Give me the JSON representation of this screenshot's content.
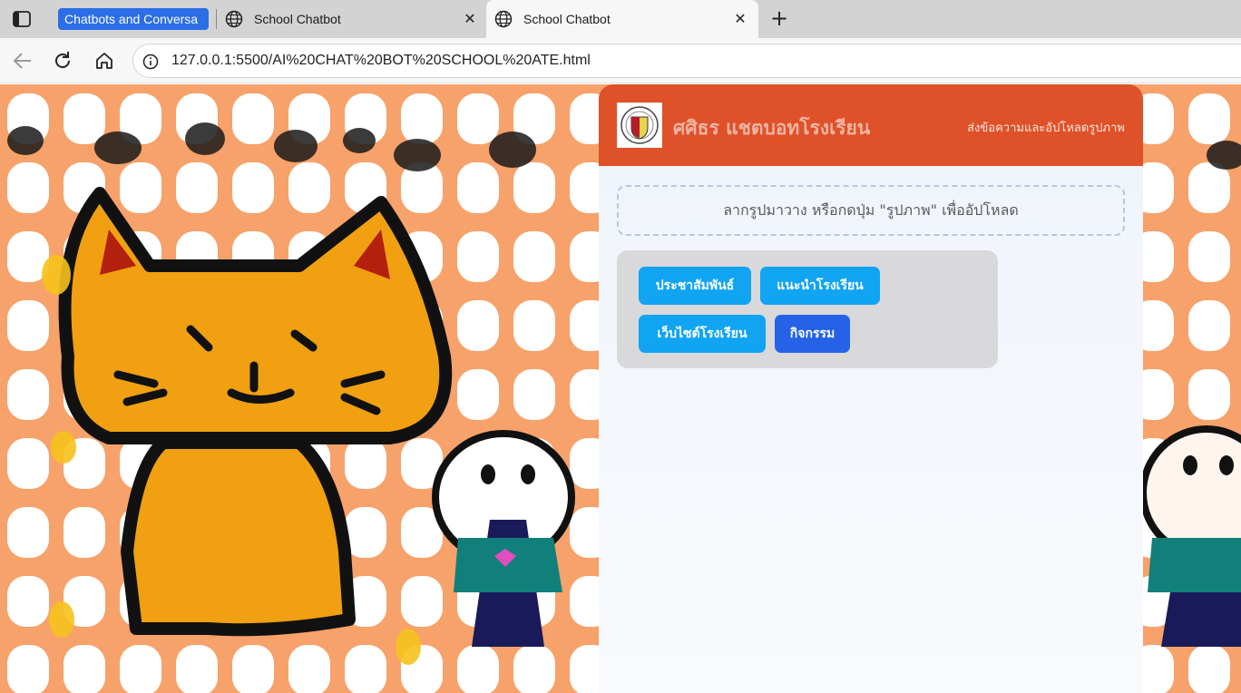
{
  "browser": {
    "tab_group_label": "Chatbots and Conversa",
    "tabs": [
      {
        "title": "School Chatbot",
        "active": false
      },
      {
        "title": "School Chatbot",
        "active": true
      }
    ],
    "address": "127.0.0.1:5500/AI%20CHAT%20BOT%20SCHOOL%20ATE.html"
  },
  "chat": {
    "title": "ศศิธร แชตบอทโรงเรียน",
    "subtitle": "ส่งข้อความและอัปโหลดรูปภาพ",
    "dropzone_text": "ลากรูปมาวาง หรือกดปุ่ม \"รูปภาพ\" เพื่ออัปโหลด",
    "quick_buttons": [
      {
        "label": "ประชาสัมพันธ์",
        "color": "#10a4f2"
      },
      {
        "label": "แนะนำโรงเรียน",
        "color": "#10a4f2"
      },
      {
        "label": "เว็บไซต์โรงเรียน",
        "color": "#10a4f2"
      },
      {
        "label": "กิจกรรม",
        "color": "#2662e8"
      }
    ]
  },
  "colors": {
    "header": "#df5128",
    "tab_group": "#2b6ee8",
    "background_pattern": "#f48a3c"
  },
  "icons": {
    "sidebar": "tab-sidebar-icon",
    "tab_favicon": "globe-icon",
    "back": "arrow-left-icon",
    "reload": "reload-icon",
    "home": "home-icon",
    "site_info": "info-icon",
    "new_tab": "plus-icon",
    "close_tab": "close-icon"
  }
}
